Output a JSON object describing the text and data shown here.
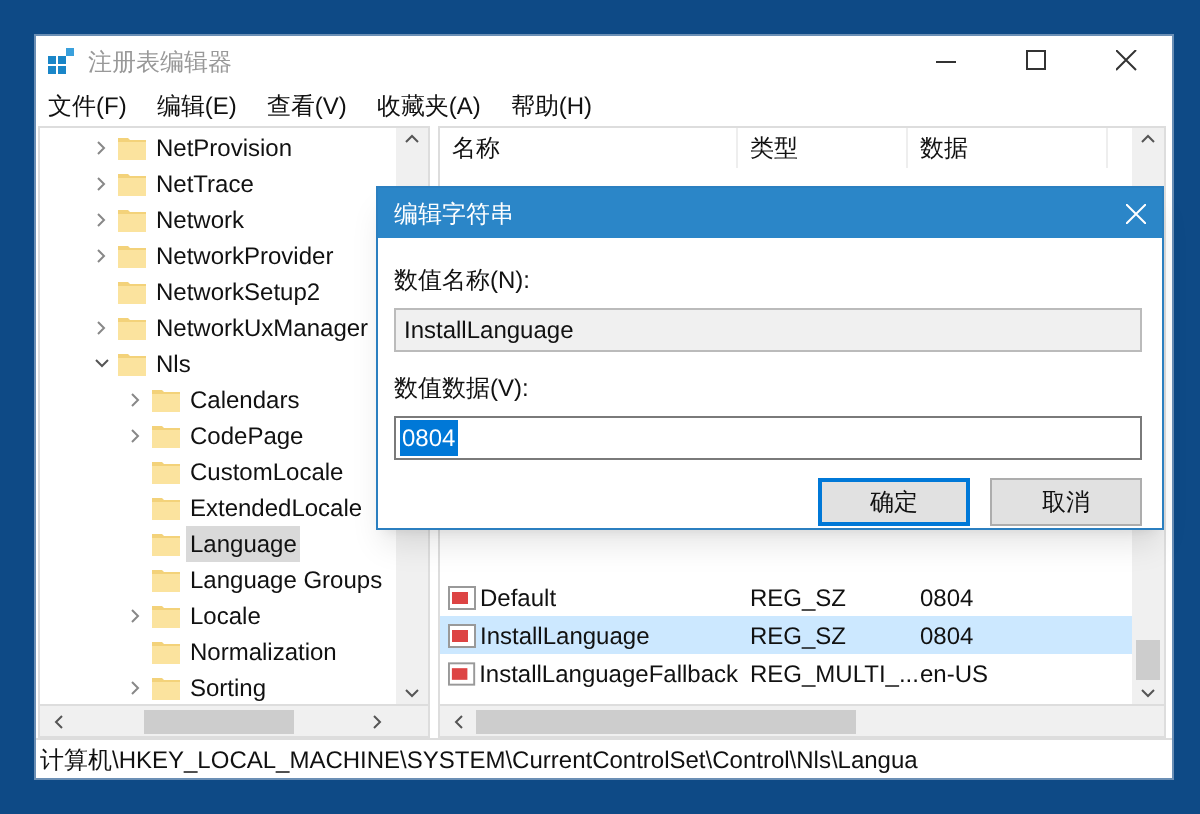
{
  "window": {
    "title": "注册表编辑器"
  },
  "menu": [
    "文件(F)",
    "编辑(E)",
    "查看(V)",
    "收藏夹(A)",
    "帮助(H)"
  ],
  "tree": [
    {
      "label": "NetProvision",
      "expanded": false,
      "selected": false
    },
    {
      "label": "NetTrace",
      "expanded": false,
      "selected": false
    },
    {
      "label": "Network",
      "expanded": false,
      "selected": false
    },
    {
      "label": "NetworkProvider",
      "expanded": false,
      "selected": false
    },
    {
      "label": "NetworkSetup2",
      "selected": false
    },
    {
      "label": "NetworkUxManager",
      "expanded": false,
      "selected": false
    },
    {
      "label": "Nls",
      "expanded": true,
      "selected": false,
      "children": [
        {
          "label": "Calendars",
          "expanded": false,
          "selected": false
        },
        {
          "label": "CodePage",
          "expanded": false,
          "selected": false
        },
        {
          "label": "CustomLocale",
          "selected": false
        },
        {
          "label": "ExtendedLocale",
          "selected": false
        },
        {
          "label": "Language",
          "selected": true
        },
        {
          "label": "Language Groups",
          "selected": false
        },
        {
          "label": "Locale",
          "expanded": false,
          "selected": false
        },
        {
          "label": "Normalization",
          "selected": false
        },
        {
          "label": "Sorting",
          "expanded": false,
          "selected": false
        }
      ]
    }
  ],
  "table": {
    "columns": [
      "名称",
      "类型",
      "数据"
    ],
    "rows": [
      {
        "name": "Default",
        "type": "REG_SZ",
        "data": "0804",
        "selected": false
      },
      {
        "name": "InstallLanguage",
        "type": "REG_SZ",
        "data": "0804",
        "selected": true
      },
      {
        "name": "InstallLanguageFallback",
        "type": "REG_MULTI_...",
        "data": "en-US",
        "selected": false
      }
    ]
  },
  "status_bar": "计算机\\HKEY_LOCAL_MACHINE\\SYSTEM\\CurrentControlSet\\Control\\Nls\\Langua",
  "dialog": {
    "title": "编辑字符串",
    "name_label": "数值名称(N):",
    "name_value": "InstallLanguage",
    "data_label": "数值数据(V):",
    "data_value": "0804",
    "buttons": [
      {
        "label": "确定",
        "default": true
      },
      {
        "label": "取消",
        "default": false
      }
    ]
  }
}
